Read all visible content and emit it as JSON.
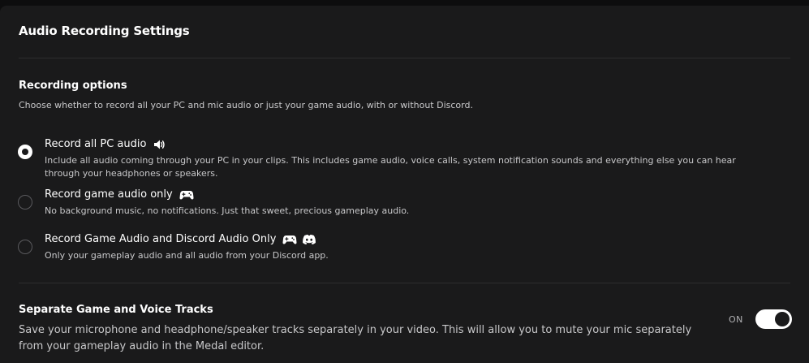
{
  "header": {
    "title": "Audio Recording Settings"
  },
  "recording": {
    "title": "Recording options",
    "description": "Choose whether to record all your PC and mic audio or just your game audio, with or without Discord.",
    "selected": "all_pc",
    "options": [
      {
        "id": "all_pc",
        "label": "Record all PC audio",
        "icons": [
          "speaker-icon"
        ],
        "description": "Include all audio coming through your PC in your clips. This includes game audio, voice calls, system notification sounds and everything else you can hear through your headphones or speakers."
      },
      {
        "id": "game_only",
        "label": "Record game audio only",
        "icons": [
          "gamepad-icon"
        ],
        "description": "No background music, no notifications. Just that sweet, precious gameplay audio."
      },
      {
        "id": "game_discord",
        "label": "Record Game Audio and Discord Audio Only",
        "icons": [
          "gamepad-icon",
          "discord-icon"
        ],
        "description": "Only your gameplay audio and all audio from your Discord app."
      }
    ]
  },
  "tracks": {
    "title": "Separate Game and Voice Tracks",
    "description": "Save your microphone and headphone/speaker tracks separately in your video. This will allow you to mute your mic separately from your gameplay audio in the Medal editor.",
    "toggle_label": "ON",
    "enabled": true
  },
  "colors": {
    "background": "#1a1a1b",
    "outer_background": "#0d0d0e",
    "text_primary": "#ffffff",
    "text_secondary": "#c8c8ca",
    "divider": "#2d2d2f",
    "accent": "#ffffff"
  }
}
